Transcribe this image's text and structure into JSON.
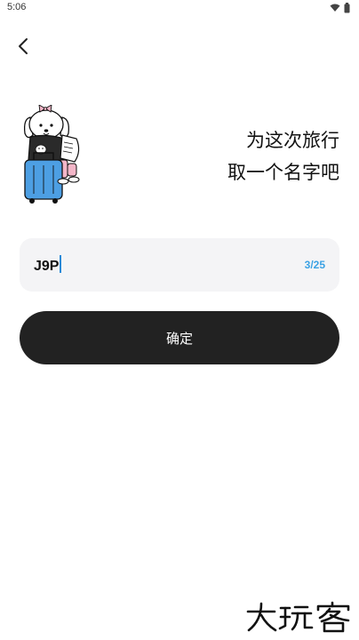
{
  "status_bar": {
    "time": "5:06",
    "icons": [
      "wifi-icon",
      "battery-icon"
    ]
  },
  "nav": {
    "back_icon": "chevron-left-icon"
  },
  "prompt": {
    "line1": "为这次旅行",
    "line2": "取一个名字吧"
  },
  "name_input": {
    "value": "J9P",
    "counter": "3/25"
  },
  "confirm": {
    "label": "确定"
  },
  "watermark": {
    "text": "大玩客"
  },
  "colors": {
    "accent": "#3ba2e4",
    "button": "#222222",
    "field_bg": "#f4f4f6"
  }
}
